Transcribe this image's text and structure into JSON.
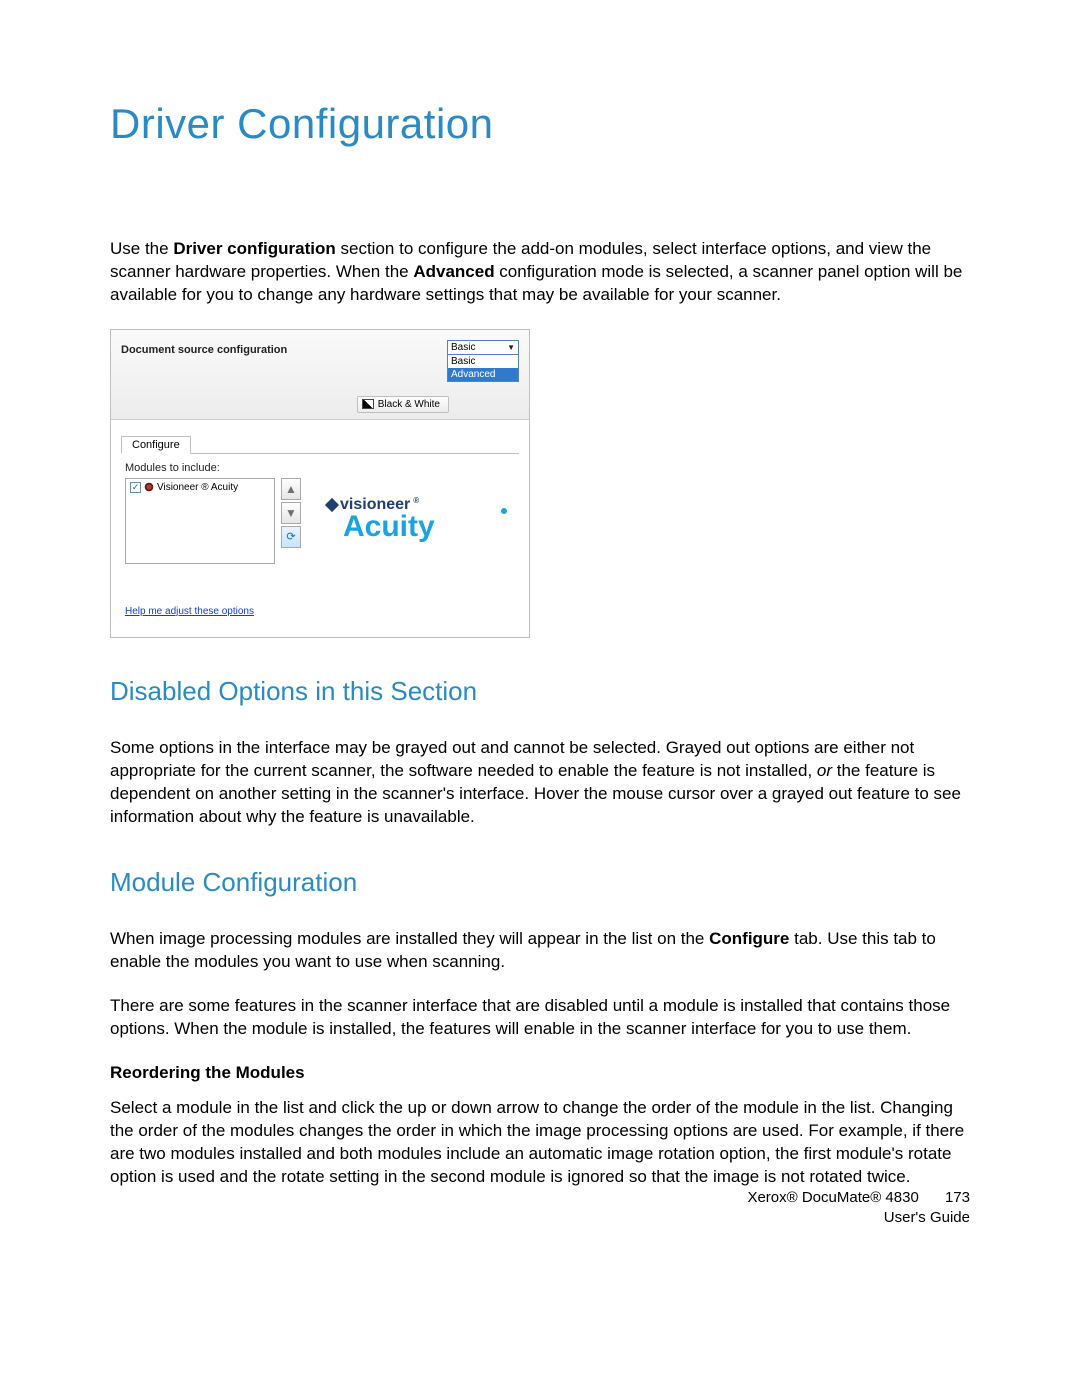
{
  "title": "Driver Configuration",
  "intro": {
    "pre": "Use the ",
    "b1": "Driver configuration",
    "mid1": " section to configure the add-on modules, select interface options, and view the scanner hardware properties. When the ",
    "b2": "Advanced",
    "mid2": " configuration mode is selected, a scanner panel option will be available for you to change any hardware settings that may be available for your scanner."
  },
  "figure": {
    "header_label": "Document source configuration",
    "combo_selected": "Basic",
    "combo_options": [
      "Basic",
      "Advanced"
    ],
    "bw_label": "Black & White",
    "tab_label": "Configure",
    "modules_label": "Modules to include:",
    "module_item": "Visioneer ® Acuity",
    "brand_top": "visioneer",
    "brand_top_suffix": "®",
    "brand_bottom": "Acuity",
    "help_link": "Help me adjust these options"
  },
  "sections": {
    "disabled_title": "Disabled Options in this Section",
    "disabled_body_pre": "Some options in the interface may be grayed out and cannot be selected. Grayed out options are either not appropriate for the current scanner, the software needed to enable the feature is not installed, ",
    "disabled_body_em": "or",
    "disabled_body_post": " the feature is dependent on another setting in the scanner's interface. Hover the mouse cursor over a grayed out feature to see information about why the feature is unavailable.",
    "module_title": "Module Configuration",
    "module_p1_pre": "When image processing modules are installed they will appear in the list on the ",
    "module_p1_b": "Configure",
    "module_p1_post": " tab. Use this tab to enable the modules you want to use when scanning.",
    "module_p2": "There are some features in the scanner interface that are disabled until a module is installed that contains those options. When the module is installed, the features will enable in the scanner interface for you to use them.",
    "reorder_title": "Reordering the Modules",
    "reorder_body": "Select a module in the list and click the up or down arrow to change the order of the module in the list. Changing the order of the modules changes the order in which the image processing options are used. For example, if there are two modules installed and both modules include an automatic image rotation option, the first module's rotate option is used and the rotate setting in the second module is ignored so that the image is not rotated twice."
  },
  "footer": {
    "product": "Xerox® DocuMate® 4830",
    "guide": "User's Guide",
    "page_number": "173"
  }
}
